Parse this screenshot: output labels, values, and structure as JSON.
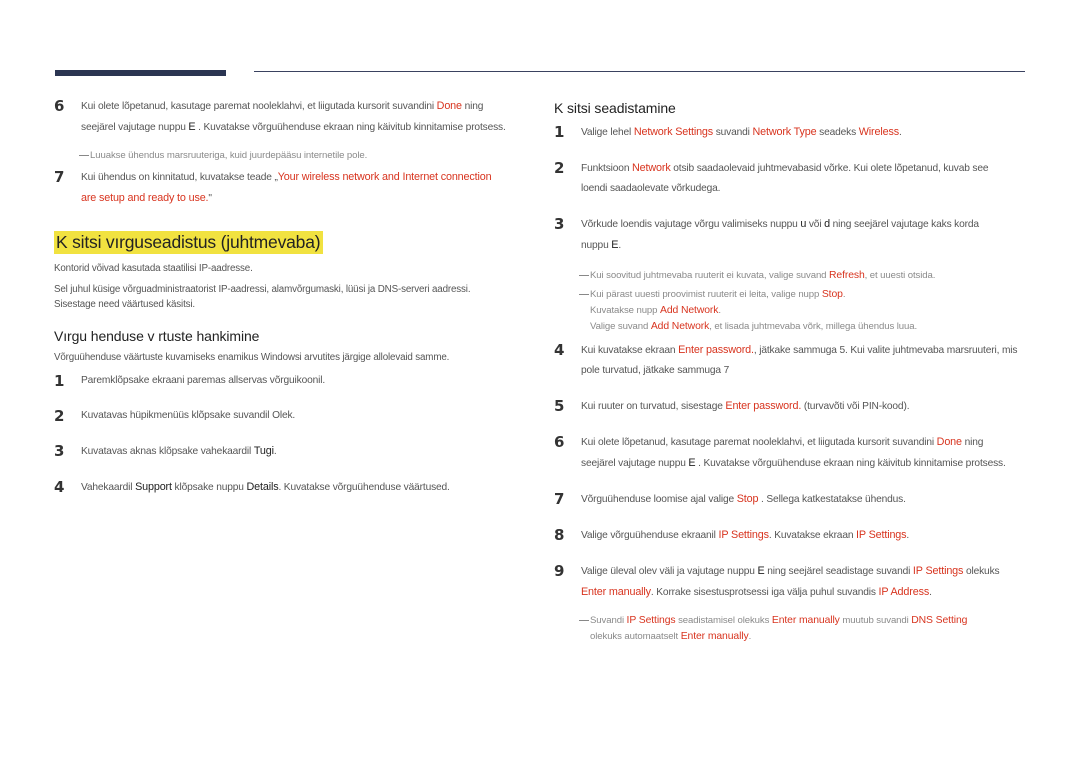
{
  "left": {
    "step6": {
      "num": "6",
      "t1": "Kui olete lõpetanud, kasutage paremat nooleklahvi, et liigutada kursorit suvandini ",
      "hl1": "Done",
      "t2": " ning",
      "t3": "seejärel vajutage nuppu ",
      "key": "E",
      "t4": "   . Kuvatakse võrguühenduse ekraan ning käivitub kinnitamise protsess."
    },
    "note1": "Luuakse ühendus marsruuteriga, kuid juurdepääsu internetile pole.",
    "step7": {
      "num": "7",
      "t1": "Kui ühendus on kinnitatud, kuvatakse teade „",
      "hl1": "Your wireless network and Internet connection",
      "hl2": "are setup and ready to use.",
      "t2": "\""
    },
    "section_title": "K sitsi vırguseadistus (juhtmevaba)",
    "para1": "Kontorid võivad kasutada staatilisi IP-aadresse.",
    "para2a": "Sel juhul küsige võrguadministraatorist IP-aadressi, alamvõrgumaski, lüüsi ja DNS-serveri aadressi.",
    "para2b": "Sisestage need väärtused käsitsi.",
    "subsection_title": "Vırgu henduse v  rtuste hankimine",
    "para3": "Võrguühenduse väärtuste kuvamiseks enamikus Windowsi arvutites järgige allolevaid samme.",
    "steps": [
      {
        "num": "1",
        "text": "Paremklõpsake ekraani paremas allservas võrguikoonil."
      },
      {
        "num": "2",
        "text": "Kuvatavas hüpikmenüüs klõpsake suvandil Olek."
      },
      {
        "num": "3",
        "t1": "Kuvatavas aknas klõpsake vahekaardil ",
        "b1": "Tugi",
        "t2": "."
      },
      {
        "num": "4",
        "t1": "Vahekaardil ",
        "b1": "Support",
        "t2": " klõpsake nuppu ",
        "b2": "Details",
        "t3": ". Kuvatakse võrguühenduse väärtused."
      }
    ]
  },
  "right": {
    "title": "K sitsi seadistamine",
    "s1": {
      "num": "1",
      "t1": "Valige lehel ",
      "h1": "Network Settings",
      "t2": " suvandi ",
      "h2": "Network Type",
      "t3": " seadeks ",
      "h3": "Wireless",
      "t4": "."
    },
    "s2": {
      "num": "2",
      "t1": "Funktsioon ",
      "h1": "Network",
      "t2": " otsib saadaolevaid juhtmevabasid võrke. Kui olete lõpetanud, kuvab see",
      "t3": "loendi saadaolevate võrkudega."
    },
    "s3": {
      "num": "3",
      "t1": "Võrkude loendis vajutage võrgu valimiseks nuppu ",
      "b1": "u",
      "t2": " või ",
      "b2": "d",
      "t3": " ning seejärel vajutage kaks korda",
      "t4": "nuppu ",
      "b3": "E",
      "t5": "."
    },
    "n1": {
      "t1": "Kui soovitud juhtmevaba ruuterit ei kuvata, valige suvand ",
      "h1": "Refresh",
      "t2": ", et uuesti otsida."
    },
    "n2": {
      "t1": "Kui pärast uuesti proovimist ruuterit ei leita, valige nupp ",
      "h1": "Stop",
      "t2": ".",
      "t3": "Kuvatakse nupp ",
      "h2": "Add Network",
      "t4": ".",
      "t5": "Valige suvand ",
      "h3": "Add Network",
      "t6": ", et lisada juhtmevaba võrk, millega ühendus luua."
    },
    "s4": {
      "num": "4",
      "t1": "Kui kuvatakse ekraan ",
      "h1": "Enter password.",
      "t2": ", jätkake sammuga 5. Kui valite juhtmevaba marsruuteri, mis",
      "t3": "pole turvatud, jätkake sammuga 7"
    },
    "s5": {
      "num": "5",
      "t1": "Kui ruuter on turvatud, sisestage ",
      "h1": "Enter password.",
      "t2": " (turvavõti või PIN-kood)."
    },
    "s6": {
      "num": "6",
      "t1": "Kui olete lõpetanud, kasutage paremat nooleklahvi, et liigutada kursorit suvandini ",
      "h1": "Done",
      "t2": " ning",
      "t3": "seejärel vajutage nuppu ",
      "b1": "E",
      "t4": "   . Kuvatakse võrguühenduse ekraan ning käivitub kinnitamise protsess."
    },
    "s7": {
      "num": "7",
      "t1": "Võrguühenduse loomise ajal valige ",
      "h1": "Stop",
      "t2": "   . Sellega katkestatakse ühendus."
    },
    "s8": {
      "num": "8",
      "t1": "Valige võrguühenduse ekraanil ",
      "h1": "IP Settings",
      "t2": ". Kuvatakse ekraan ",
      "h2": "IP Settings",
      "t3": "."
    },
    "s9": {
      "num": "9",
      "t1": "Valige üleval olev väli ja vajutage nuppu ",
      "b1": "E",
      "t2": " ning seejärel seadistage suvandi ",
      "h1": "IP Settings",
      "t3": " olekuks",
      "h2": "Enter manually",
      "t4": ". Korrake sisestusprotsessi iga välja puhul suvandis ",
      "h3": "IP Address",
      "t5": "."
    },
    "n3": {
      "t1": "Suvandi ",
      "h1": "IP Settings",
      "t2": " seadistamisel olekuks ",
      "h2": "Enter manually",
      "t3": " muutub suvandi ",
      "h3": "DNS Setting",
      "t4": "olekuks automaatselt ",
      "h4": "Enter manually",
      "t5": "."
    }
  }
}
